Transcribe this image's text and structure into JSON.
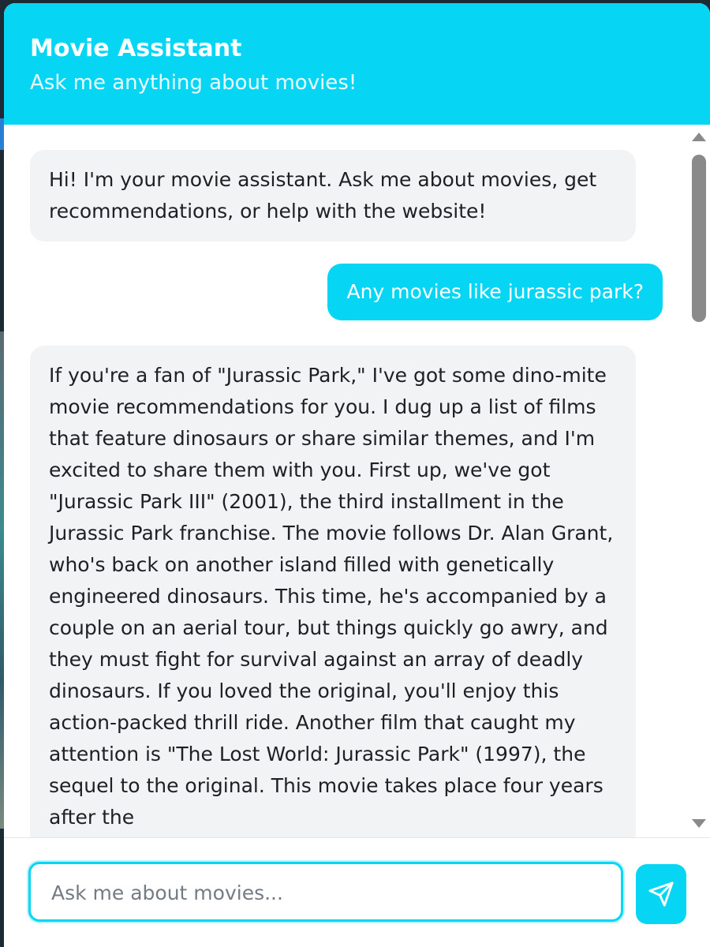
{
  "header": {
    "title": "Movie Assistant",
    "subtitle": "Ask me anything about movies!"
  },
  "messages": [
    {
      "role": "assistant",
      "text": "Hi! I'm your movie assistant. Ask me about movies, get recommendations, or help with the website!"
    },
    {
      "role": "user",
      "text": "Any movies like jurassic park?"
    },
    {
      "role": "assistant",
      "text": "If you're a fan of \"Jurassic Park,\" I've got some dino-mite movie recommendations for you. I dug up a list of films that feature dinosaurs or share similar themes, and I'm excited to share them with you. First up, we've got \"Jurassic Park III\" (2001), the third installment in the Jurassic Park franchise. The movie follows Dr. Alan Grant, who's back on another island filled with genetically engineered dinosaurs. This time, he's accompanied by a couple on an aerial tour, but things quickly go awry, and they must fight for survival against an array of deadly dinosaurs. If you loved the original, you'll enjoy this action-packed thrill ride. Another film that caught my attention is \"The Lost World: Jurassic Park\" (1997), the sequel to the original. This movie takes place four years after the"
    }
  ],
  "composer": {
    "placeholder": "Ask me about movies...",
    "value": "",
    "send_icon": "send-icon"
  },
  "colors": {
    "accent": "#06d6f3",
    "bot_bubble": "#f2f3f5",
    "text": "#1f1f24"
  }
}
